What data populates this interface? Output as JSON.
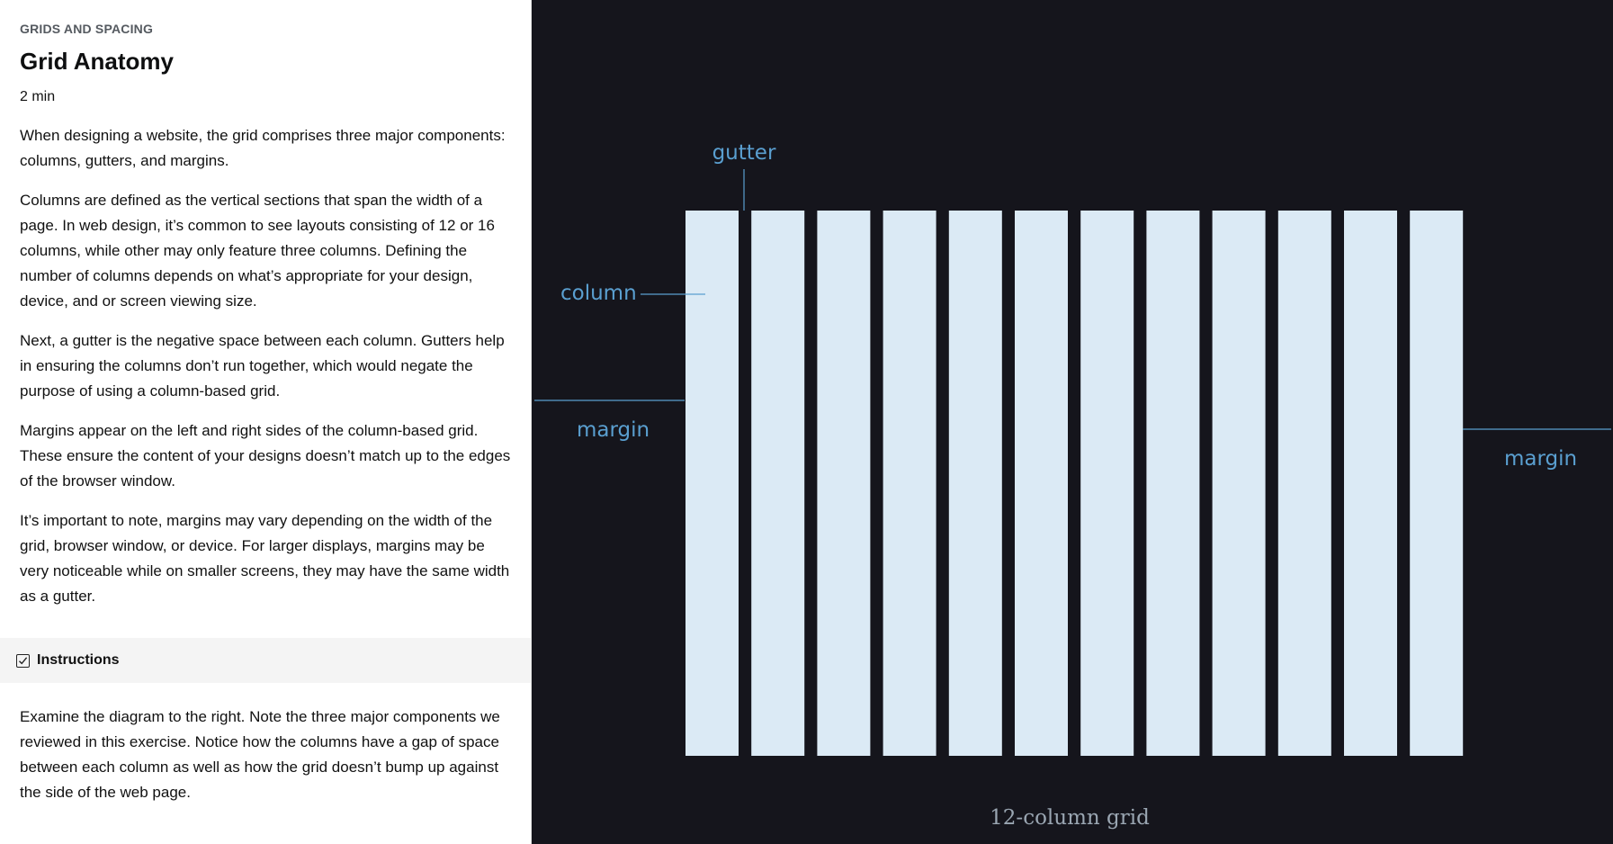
{
  "lesson": {
    "category": "GRIDS AND SPACING",
    "title": "Grid Anatomy",
    "duration": "2 min",
    "paragraphs": [
      "When designing a website, the grid comprises three major components: columns, gutters, and margins.",
      "Columns are defined as the vertical sections that span the width of a page. In web design, it’s common to see layouts consisting of 12 or 16 columns, while other may only feature three columns. Defining the number of columns depends on what’s appropriate for your design, device, and or screen viewing size.",
      "Next, a gutter is the negative space between each column. Gutters help in ensuring the columns don’t run together, which would negate the purpose of using a column-based grid.",
      "Margins appear on the left and right sides of the column-based grid. These ensure the content of your designs doesn’t match up to the edges of the browser window.",
      "It’s important to note, margins may vary depending on the width of the grid, browser window, or device. For larger displays, margins may be very noticeable while on smaller screens, they may have the same width as a gutter."
    ]
  },
  "instructions": {
    "label": "Instructions",
    "text": "Examine the diagram to the right. Note the three major components we reviewed in this exercise. Notice how the columns have a gap of space between each column as well as how the grid doesn’t bump up against the side of the web page.",
    "icon": "checkbox-icon"
  },
  "diagram": {
    "column_count": 12,
    "labels": {
      "gutter": "gutter",
      "column": "column",
      "margin_left": "margin",
      "margin_right": "margin",
      "caption": "12-column grid"
    },
    "colors": {
      "background": "#15151c",
      "column_fill": "#dbeaf5",
      "annotation": "#5a9fd0",
      "caption": "#9aa6b2"
    }
  }
}
